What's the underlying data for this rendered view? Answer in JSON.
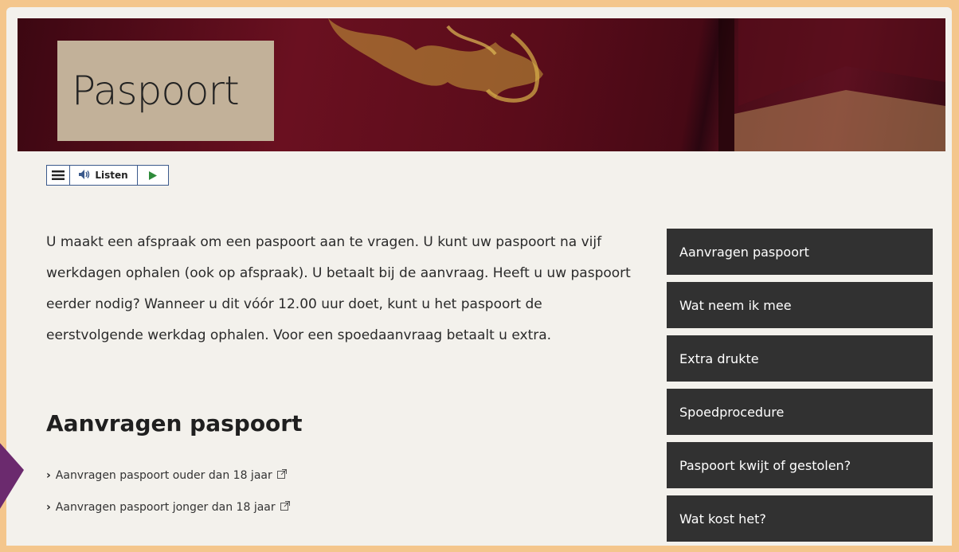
{
  "hero": {
    "title": "Paspoort"
  },
  "listen_bar": {
    "menu_icon": "menu-icon",
    "speaker_icon": "speaker-icon",
    "label": "Listen",
    "play_icon": "play-icon"
  },
  "intro": "U maakt een afspraak om een paspoort aan te vragen. U kunt uw paspoort na vijf werkdagen ophalen (ook op afspraak). U betaalt bij de aanvraag. Heeft u uw paspoort eerder nodig? Wanneer u dit vóór 12.00 uur doet, kunt u het paspoort de eerstvolgende werkdag ophalen. Voor een spoedaanvraag betaalt u extra.",
  "section": {
    "title": "Aanvragen paspoort",
    "links": [
      {
        "label": "Aanvragen paspoort ouder dan 18 jaar"
      },
      {
        "label": "Aanvragen paspoort jonger dan 18 jaar"
      }
    ]
  },
  "sidenav": {
    "items": [
      {
        "label": "Aanvragen paspoort"
      },
      {
        "label": "Wat neem ik mee"
      },
      {
        "label": "Extra drukte"
      },
      {
        "label": "Spoedprocedure"
      },
      {
        "label": "Paspoort kwijt of gestolen?"
      },
      {
        "label": "Wat kost het?"
      }
    ]
  },
  "colors": {
    "page_border": "#f4c68c",
    "content_bg": "#f3f1ec",
    "title_box": "#c2b199",
    "sidenav_bg": "#313131",
    "accent_arrow": "#6b2a6e"
  }
}
